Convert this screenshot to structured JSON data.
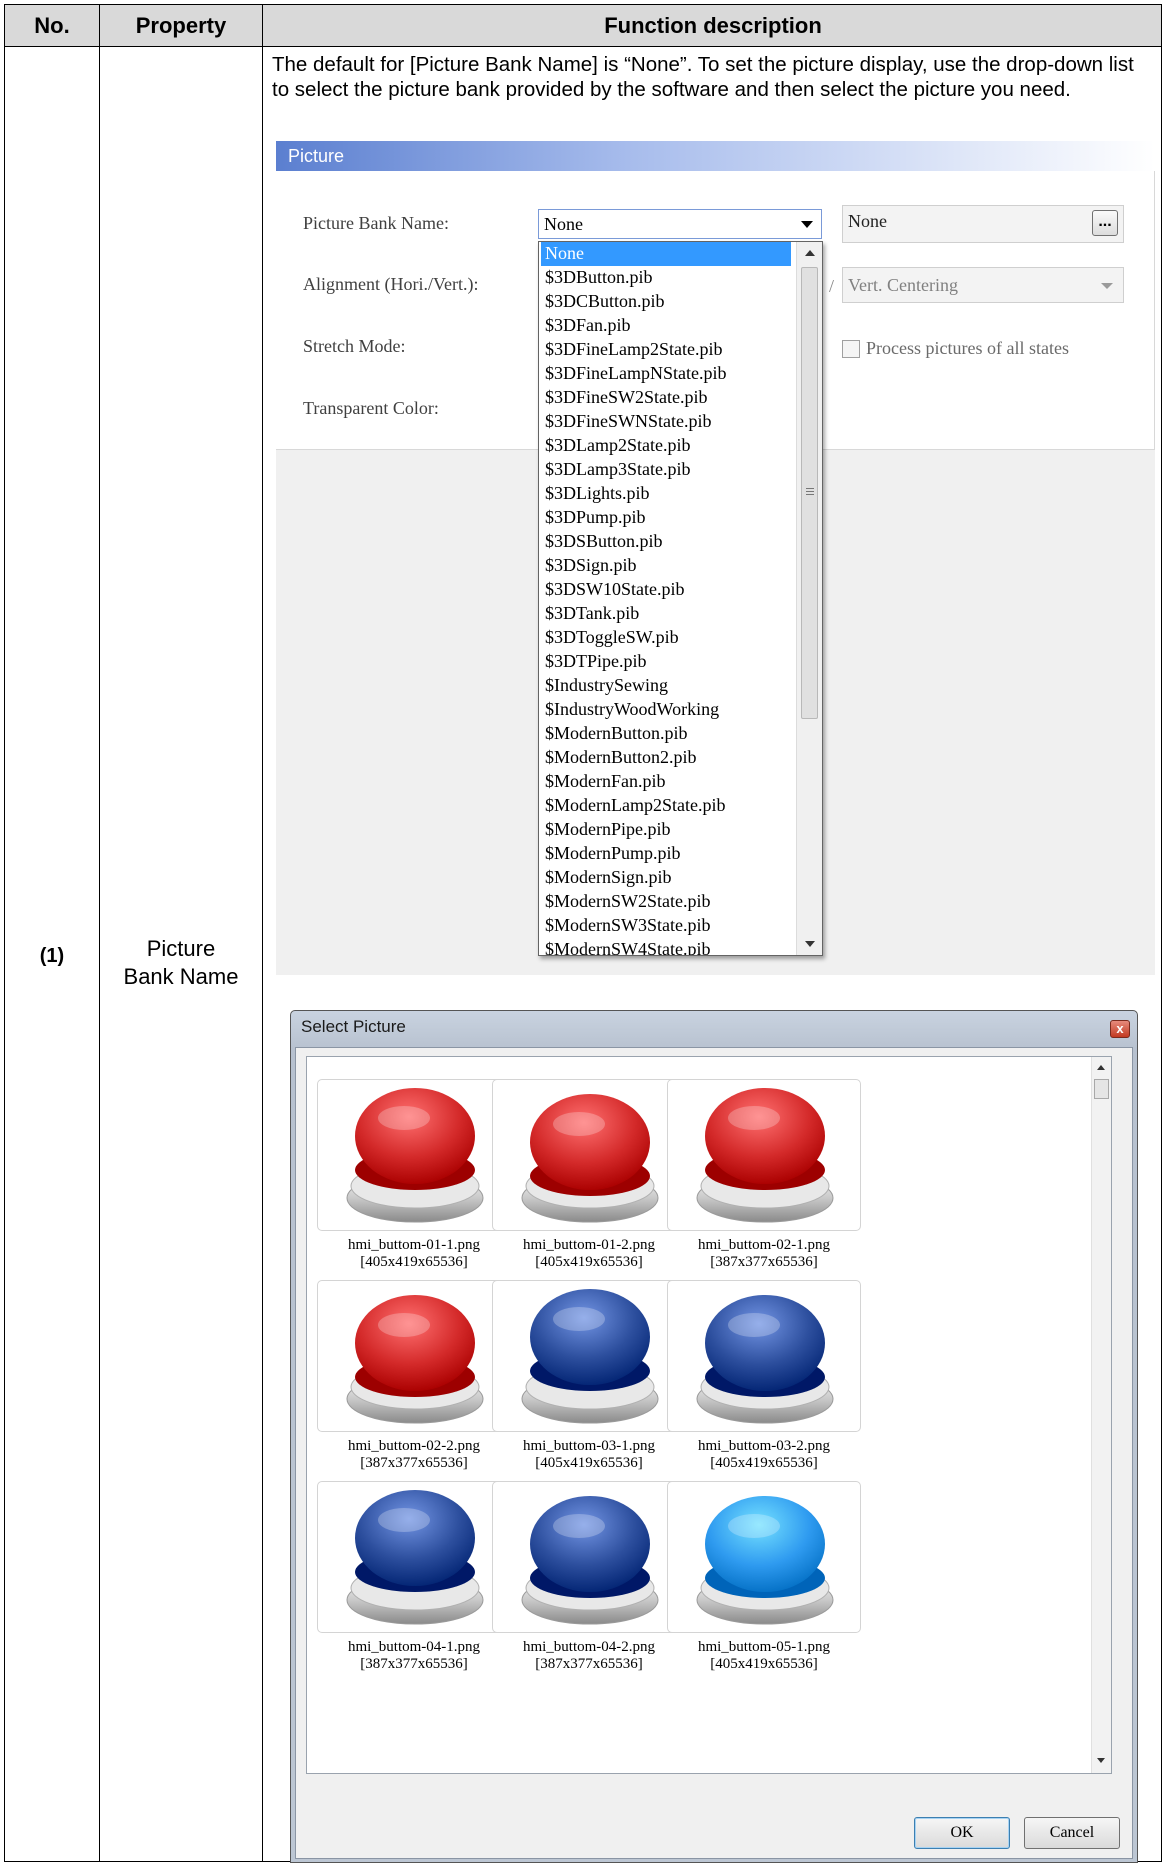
{
  "table": {
    "header": {
      "no": "No.",
      "property": "Property",
      "function": "Function description"
    },
    "row": {
      "no": "(1)",
      "property_line1": "Picture",
      "property_line2": "Bank Name",
      "intro": "The default for [Picture Bank Name] is “None”. To set the picture display, use the drop-down list to select the picture bank provided by the software and then select the picture you need."
    }
  },
  "picture_panel": {
    "title": "Picture",
    "labels": {
      "bank_name": "Picture Bank Name:",
      "alignment": "Alignment (Hori./Vert.):",
      "stretch_mode": "Stretch Mode:",
      "transparent_color": "Transparent Color:"
    },
    "bank_combo_value": "None",
    "picture_field_value": "None",
    "browse_button": "...",
    "slash": "/",
    "vert_alignment_value": "Vert. Centering",
    "process_all_states_label": "Process pictures of all states",
    "dropdown_items": [
      "None",
      "$3DButton.pib",
      "$3DCButton.pib",
      "$3DFan.pib",
      "$3DFineLamp2State.pib",
      "$3DFineLampNState.pib",
      "$3DFineSW2State.pib",
      "$3DFineSWNState.pib",
      "$3DLamp2State.pib",
      "$3DLamp3State.pib",
      "$3DLights.pib",
      "$3DPump.pib",
      "$3DSButton.pib",
      "$3DSign.pib",
      "$3DSW10State.pib",
      "$3DTank.pib",
      "$3DToggleSW.pib",
      "$3DTPipe.pib",
      "$IndustrySewing",
      "$IndustryWoodWorking",
      "$ModernButton.pib",
      "$ModernButton2.pib",
      "$ModernFan.pib",
      "$ModernLamp2State.pib",
      "$ModernPipe.pib",
      "$ModernPump.pib",
      "$ModernSign.pib",
      "$ModernSW2State.pib",
      "$ModernSW3State.pib",
      "$ModernSW4State.pib"
    ]
  },
  "select_picture_dialog": {
    "title": "Select Picture",
    "close_glyph": "x",
    "ok_label": "OK",
    "cancel_label": "Cancel",
    "pictures": [
      {
        "file": "hmi_buttom-01-1.png",
        "info": "[405x419x65536]",
        "color": "#d42a2a",
        "style": "tall"
      },
      {
        "file": "hmi_buttom-01-2.png",
        "info": "[405x419x65536]",
        "color": "#d42a2a",
        "style": "pressed"
      },
      {
        "file": "hmi_buttom-02-1.png",
        "info": "[387x377x65536]",
        "color": "#d42a2a",
        "style": "tall"
      },
      {
        "file": "hmi_buttom-02-2.png",
        "info": "[387x377x65536]",
        "color": "#d42a2a",
        "style": "pressed"
      },
      {
        "file": "hmi_buttom-03-1.png",
        "info": "[405x419x65536]",
        "color": "#2d4f9e",
        "style": "tall"
      },
      {
        "file": "hmi_buttom-03-2.png",
        "info": "[405x419x65536]",
        "color": "#2d4f9e",
        "style": "pressed"
      },
      {
        "file": "hmi_buttom-04-1.png",
        "info": "[387x377x65536]",
        "color": "#2d4f9e",
        "style": "tall"
      },
      {
        "file": "hmi_buttom-04-2.png",
        "info": "[387x377x65536]",
        "color": "#2d4f9e",
        "style": "pressed"
      },
      {
        "file": "hmi_buttom-05-1.png",
        "info": "[405x419x65536]",
        "color": "#2f9bf0",
        "style": "pressed"
      }
    ]
  }
}
